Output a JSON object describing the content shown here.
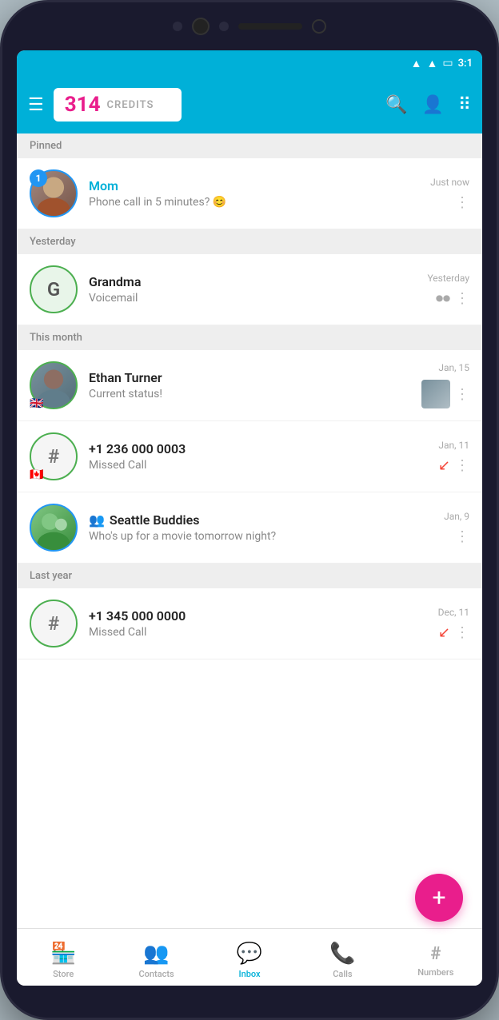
{
  "phone": {
    "status_bar": {
      "time": "3:1",
      "wifi": "▲",
      "signal": "▲",
      "battery": "▭"
    }
  },
  "header": {
    "menu_label": "☰",
    "credits_number": "314",
    "credits_label": "CREDITS",
    "search_icon": "🔍",
    "contact_icon": "👤",
    "keypad_icon": "⠿"
  },
  "sections": {
    "pinned": "Pinned",
    "yesterday": "Yesterday",
    "this_month": "This month",
    "last_year": "Last year"
  },
  "conversations": [
    {
      "id": "mom",
      "name": "Mom",
      "preview": "Phone call in 5 minutes? 😊",
      "time": "Just now",
      "badge": "1",
      "avatar_type": "photo",
      "avatar_color": "mom",
      "border": "blue",
      "has_more": true
    },
    {
      "id": "grandma",
      "name": "Grandma",
      "preview": "Voicemail",
      "time": "Yesterday",
      "badge": null,
      "avatar_type": "initial",
      "avatar_initial": "G",
      "border": "green",
      "has_voicemail": true,
      "has_more": true
    },
    {
      "id": "ethan",
      "name": "Ethan Turner",
      "preview": "Current status!",
      "time": "Jan, 15",
      "badge": null,
      "avatar_type": "photo",
      "avatar_color": "ethan",
      "border": "green",
      "has_flag": "🇬🇧",
      "has_thumb": true,
      "has_more": true
    },
    {
      "id": "phone1",
      "name": "+1 236 000 0003",
      "preview": "Missed Call",
      "time": "Jan, 11",
      "badge": null,
      "avatar_type": "initial",
      "avatar_initial": "#",
      "border": "green",
      "has_flag": "🇨🇦",
      "has_missed": true,
      "has_more": true
    },
    {
      "id": "seattle",
      "name": "Seattle Buddies",
      "preview": "Who's up for a movie tomorrow night?",
      "time": "Jan, 9",
      "badge": null,
      "avatar_type": "photo",
      "avatar_color": "seattle",
      "border": "blue",
      "is_group": true,
      "has_more": true
    },
    {
      "id": "phone2",
      "name": "+1 345 000 0000",
      "preview": "Missed Call",
      "time": "Dec, 11",
      "badge": null,
      "avatar_type": "initial",
      "avatar_initial": "#",
      "border": "green",
      "has_flag": null,
      "has_missed": true,
      "has_more": true
    }
  ],
  "fab": {
    "label": "+"
  },
  "bottom_nav": {
    "items": [
      {
        "id": "store",
        "icon": "🏪",
        "label": "Store",
        "active": false
      },
      {
        "id": "contacts",
        "icon": "👥",
        "label": "Contacts",
        "active": false
      },
      {
        "id": "inbox",
        "icon": "💬",
        "label": "Inbox",
        "active": true
      },
      {
        "id": "calls",
        "icon": "📞",
        "label": "Calls",
        "active": false
      },
      {
        "id": "numbers",
        "icon": "#",
        "label": "Numbers",
        "active": false
      }
    ]
  }
}
